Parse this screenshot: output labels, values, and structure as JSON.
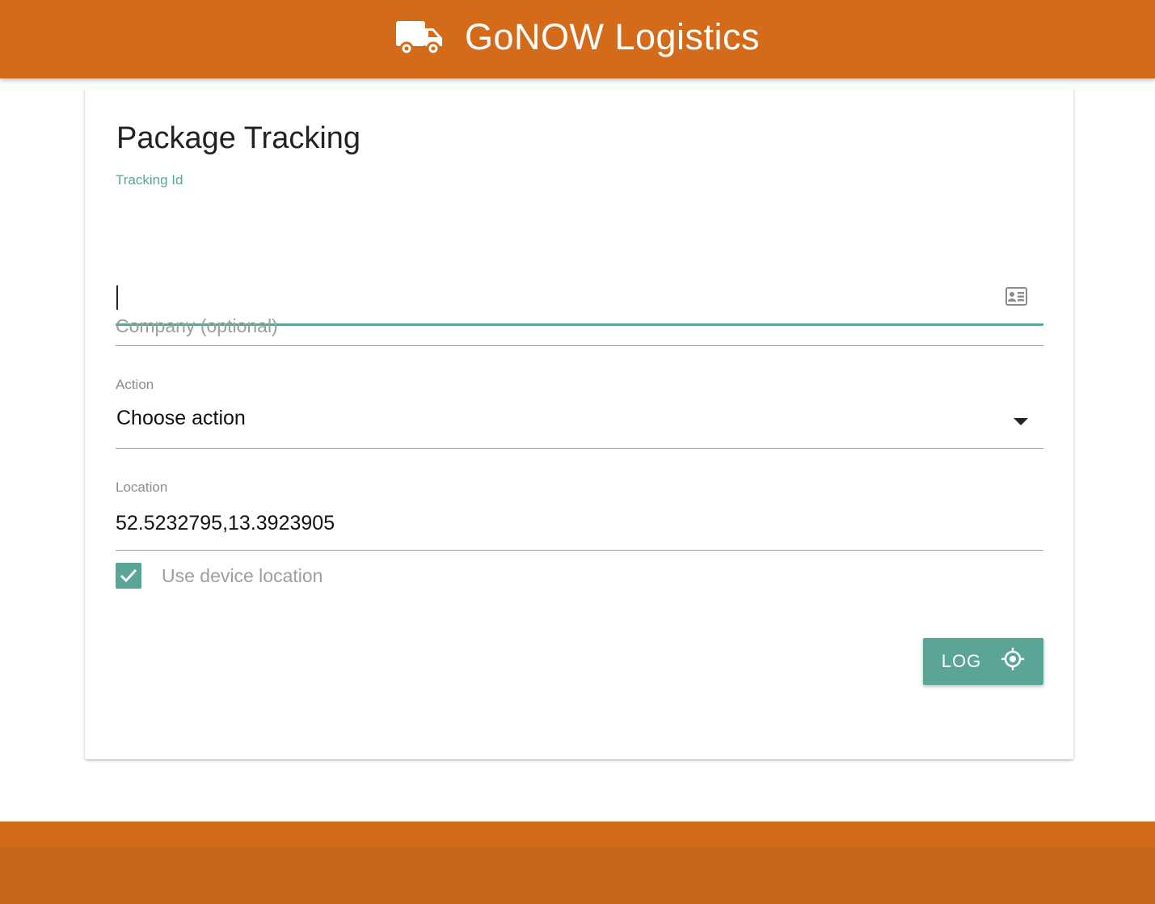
{
  "app": {
    "title": "GoNOW Logistics",
    "logo_icon": "truck-icon",
    "brand_color": "#d46b1a",
    "accent_color": "#5aa596"
  },
  "form": {
    "title": "Package Tracking",
    "tracking_id": {
      "label": "Tracking Id",
      "value": "",
      "icon": "id-card-icon"
    },
    "company": {
      "placeholder": "Company (optional)",
      "value": ""
    },
    "action": {
      "label": "Action",
      "selected": "Choose action",
      "icon": "dropdown-arrow-icon"
    },
    "location": {
      "label": "Location",
      "value": "52.5232795,13.3923905"
    },
    "use_device_location": {
      "label": "Use device location",
      "checked": true
    },
    "log_button": {
      "label": "LOG",
      "icon": "my-location-icon"
    }
  }
}
